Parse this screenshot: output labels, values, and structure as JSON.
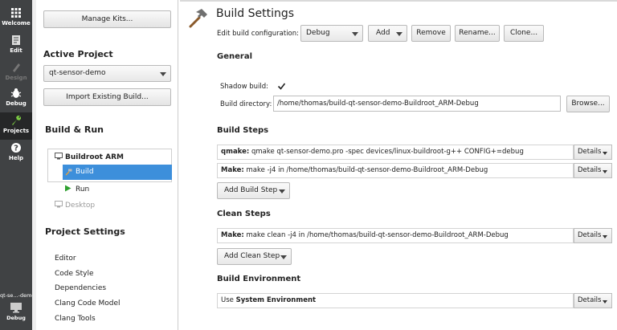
{
  "modes": [
    {
      "label": "Welcome",
      "icon": "grid-icon"
    },
    {
      "label": "Edit",
      "icon": "document-icon"
    },
    {
      "label": "Design",
      "icon": "pen-icon"
    },
    {
      "label": "Debug",
      "icon": "bug-icon"
    },
    {
      "label": "Projects",
      "icon": "wrench-icon"
    },
    {
      "label": "Help",
      "icon": "help-icon"
    }
  ],
  "kit_selector": {
    "project": "qt-se...-demo",
    "build_type": "Debug"
  },
  "nav": {
    "manage_kits": "Manage Kits...",
    "active_project_heading": "Active Project",
    "active_project": "qt-sensor-demo",
    "import_build": "Import Existing Build...",
    "build_run_heading": "Build & Run",
    "kit_name": "Buildroot ARM",
    "build_item": "Build",
    "run_item": "Run",
    "desktop_item": "Desktop",
    "project_settings_heading": "Project Settings",
    "settings_items": [
      "Editor",
      "Code Style",
      "Dependencies",
      "Clang Code Model",
      "Clang Tools"
    ]
  },
  "build_settings": {
    "title": "Build Settings",
    "edit_config_label": "Edit build configuration:",
    "config_value": "Debug",
    "add": "Add",
    "remove": "Remove",
    "rename": "Rename...",
    "clone": "Clone...",
    "general_heading": "General",
    "shadow_label": "Shadow build:",
    "build_dir_label": "Build directory:",
    "build_dir_value": "/home/thomas/build-qt-sensor-demo-Buildroot_ARM-Debug",
    "browse": "Browse...",
    "build_steps_heading": "Build Steps",
    "qmake_prefix": "qmake:",
    "qmake_cmd": "qmake qt-sensor-demo.pro -spec devices/linux-buildroot-g++ CONFIG+=debug",
    "make_prefix": "Make:",
    "make_cmd": "make -j4 in /home/thomas/build-qt-sensor-demo-Buildroot_ARM-Debug",
    "add_build_step": "Add Build Step",
    "clean_steps_heading": "Clean Steps",
    "clean_prefix": "Make:",
    "clean_cmd": "make clean -j4 in /home/thomas/build-qt-sensor-demo-Buildroot_ARM-Debug",
    "add_clean_step": "Add Clean Step",
    "env_heading": "Build Environment",
    "env_use": "Use",
    "env_value": "System Environment",
    "details": "Details"
  },
  "colors": {
    "accent": "#3d8fdb",
    "modebar": "#404244",
    "run_green": "#2fa030"
  }
}
